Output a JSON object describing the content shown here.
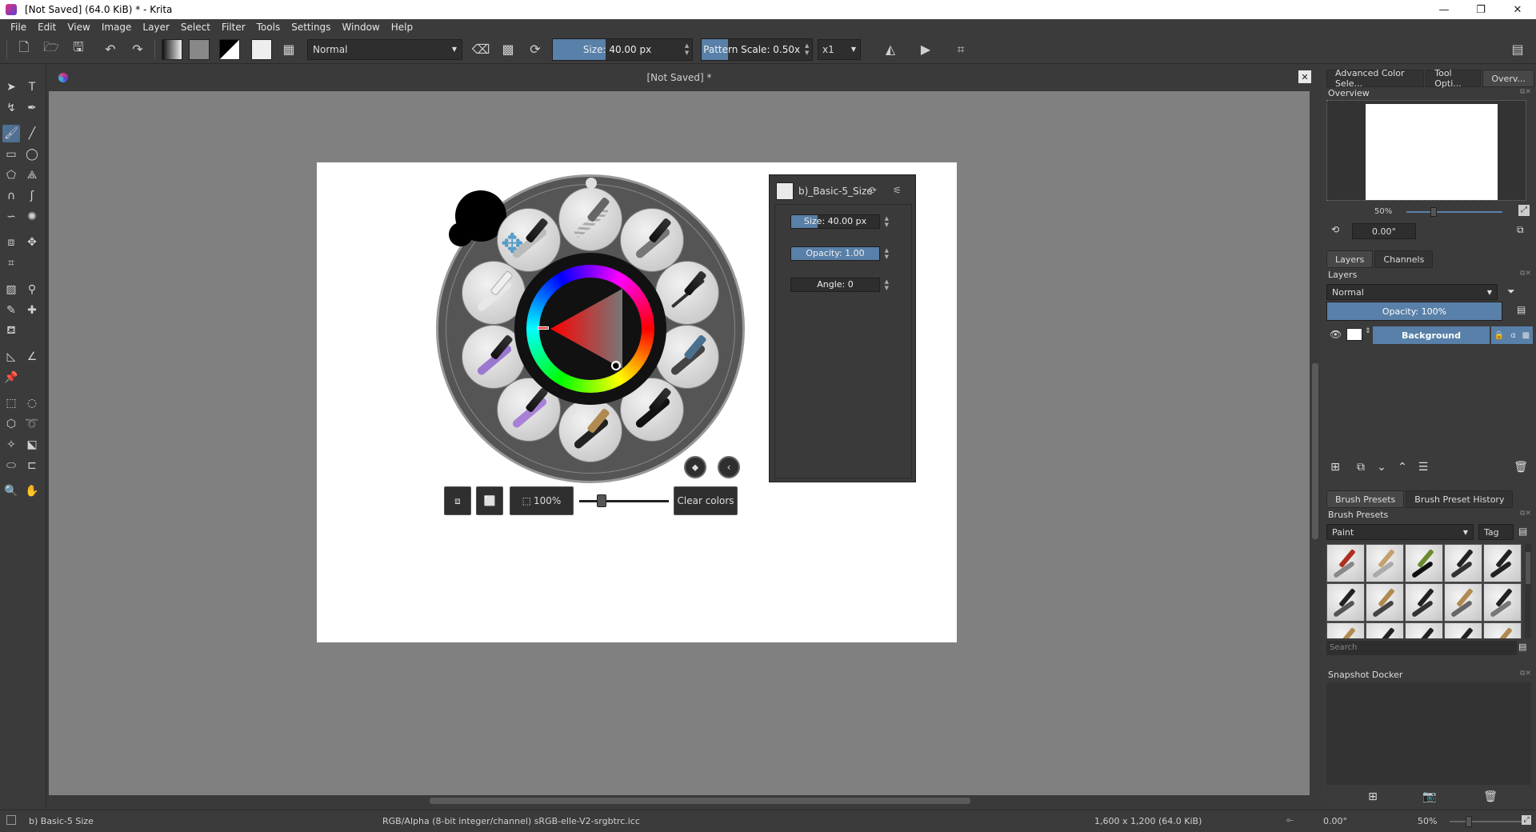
{
  "window": {
    "title": "[Not Saved]  (64.0 KiB)  * - Krita",
    "minimize": "—",
    "maximize": "❐",
    "close": "✕"
  },
  "menu": [
    "File",
    "Edit",
    "View",
    "Image",
    "Layer",
    "Select",
    "Filter",
    "Tools",
    "Settings",
    "Window",
    "Help"
  ],
  "toolbar": {
    "blend_mode": "Normal",
    "size": {
      "label": "Size: 40.00 px",
      "fill_fraction": 0.38
    },
    "pattern_scale": {
      "label": "Pattern Scale: 0.50x",
      "fill_fraction": 0.24
    },
    "multiplier": "x1"
  },
  "document": {
    "tab_title": "[Not Saved]  *",
    "close": "✕"
  },
  "palette": {
    "zoom_label": "100%",
    "clear_colors": "Clear colors",
    "zoom_slider_fraction": 0.2
  },
  "hud": {
    "preset_name": "b)_Basic-5_Size",
    "size": {
      "label": "Size: 40.00 px",
      "fill_fraction": 0.3
    },
    "opacity": {
      "label": "Opacity: 1.00",
      "fill_fraction": 1.0
    },
    "angle": {
      "label": "Angle: 0",
      "fill_fraction": 0.0
    }
  },
  "dock": {
    "top_tabs": [
      "Advanced Color Sele...",
      "Tool Opti...",
      "Overv..."
    ],
    "overview": {
      "title": "Overview",
      "zoom": "50%",
      "rotation": "0.00°"
    },
    "layers_tabs": [
      "Layers",
      "Channels"
    ],
    "layers": {
      "title": "Layers",
      "blend_mode": "Normal",
      "opacity": "Opacity:  100%",
      "rows": [
        {
          "name": "Background"
        }
      ]
    },
    "brush_tabs": [
      "Brush Presets",
      "Brush Preset History"
    ],
    "brush_presets": {
      "title": "Brush Presets",
      "tag_group": "Paint",
      "tag_label": "Tag",
      "search_placeholder": "Search"
    },
    "snapshot": {
      "title": "Snapshot Docker"
    }
  },
  "status": {
    "preset": "b) Basic-5 Size",
    "color_profile": "RGB/Alpha (8-bit integer/channel)  sRGB-elle-V2-srgbtrc.icc",
    "dimensions": "1,600 x 1,200 (64.0 KiB)",
    "rotation": "0.00°",
    "zoom": "50%"
  },
  "colors": {
    "accent": "#5880a8",
    "canvas_bg": "#808080",
    "ui_bg": "#3b3b3b"
  }
}
